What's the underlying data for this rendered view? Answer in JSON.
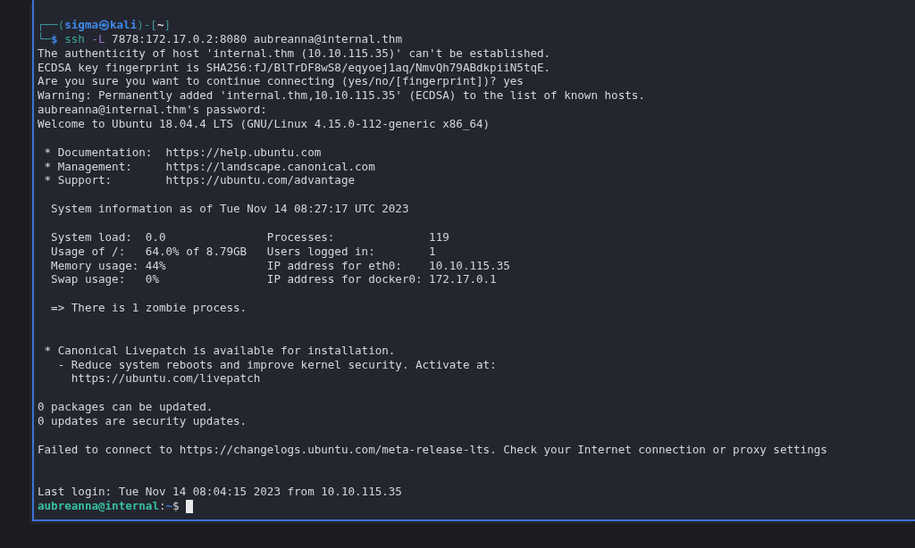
{
  "terminal": {
    "lines": [
      {
        "kind": "prompt",
        "segments": [
          {
            "text": "┌──(",
            "kind": "frame"
          },
          {
            "text": "sigma㉿kali",
            "kind": "user"
          },
          {
            "text": ")-[",
            "kind": "frame"
          },
          {
            "text": "~",
            "kind": "directory"
          },
          {
            "text": "]",
            "kind": "frame"
          }
        ]
      },
      {
        "kind": "command",
        "segments": [
          {
            "text": "└─",
            "kind": "frame"
          },
          {
            "text": "$",
            "kind": "sign"
          },
          {
            "text": " ssh",
            "kind": "command"
          },
          {
            "text": " -L",
            "kind": "option"
          },
          {
            "text": " 7878:172.17.0.2:8080 aubreanna@internal.thm",
            "kind": "plain"
          }
        ]
      },
      {
        "kind": "output",
        "text": "The authenticity of host 'internal.thm (10.10.115.35)' can't be established.\nECDSA key fingerprint is SHA256:fJ/BlTrDF8wS8/eqyoej1aq/NmvQh79ABdkpiiN5tqE.\nAre you sure you want to continue connecting (yes/no/[fingerprint])? yes\nWarning: Permanently added 'internal.thm,10.10.115.35' (ECDSA) to the list of known hosts.\naubreanna@internal.thm's password:\nWelcome to Ubuntu 18.04.4 LTS (GNU/Linux 4.15.0-112-generic x86_64)\n\n * Documentation:  https://help.ubuntu.com\n * Management:     https://landscape.canonical.com\n * Support:        https://ubuntu.com/advantage\n\n  System information as of Tue Nov 14 08:27:17 UTC 2023\n\n  System load:  0.0               Processes:              119\n  Usage of /:   64.0% of 8.79GB   Users logged in:        1\n  Memory usage: 44%               IP address for eth0:    10.10.115.35\n  Swap usage:   0%                IP address for docker0: 172.17.0.1\n\n  => There is 1 zombie process.\n\n\n * Canonical Livepatch is available for installation.\n   - Reduce system reboots and improve kernel security. Activate at:\n     https://ubuntu.com/livepatch\n\n0 packages can be updated.\n0 updates are security updates.\n\nFailed to connect to https://changelogs.ubuntu.com/meta-release-lts. Check your Internet connection or proxy settings\n\n\nLast login: Tue Nov 14 08:04:15 2023 from 10.10.115.35"
      },
      {
        "kind": "prompt",
        "cursor": true,
        "segments": [
          {
            "text": "aubreanna@internal",
            "kind": "bash_user"
          },
          {
            "text": ":",
            "kind": "plain"
          },
          {
            "text": "~",
            "kind": "bash_directory"
          },
          {
            "text": "$",
            "kind": "plain"
          }
        ]
      }
    ]
  }
}
